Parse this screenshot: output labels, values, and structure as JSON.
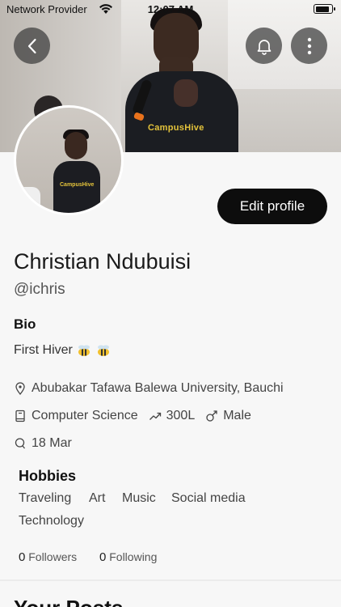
{
  "status_bar": {
    "carrier": "Network Provider",
    "time": "12:07 AM",
    "battery_level": 0.9
  },
  "header": {
    "back_icon": "chevron-left-icon",
    "notification_icon": "bell-icon",
    "more_icon": "more-vertical-icon"
  },
  "cover": {
    "shirt_text": "CampusHive"
  },
  "profile": {
    "edit_label": "Edit profile",
    "name": "Christian Ndubuisi",
    "handle": "@ichris",
    "bio_heading": "Bio",
    "bio_text": "First Hiver",
    "bio_emoji": "bee-emoji",
    "university": "Abubakar Tafawa Balewa University, Bauchi",
    "department": "Computer Science",
    "level": "300L",
    "gender": "Male",
    "birthday": "18 Mar"
  },
  "hobbies": {
    "heading": "Hobbies",
    "items": [
      "Traveling",
      "Art",
      "Music",
      "Social media",
      "Technology"
    ]
  },
  "stats": {
    "followers_count": "0",
    "followers_label": "Followers",
    "following_count": "0",
    "following_label": "Following"
  },
  "posts": {
    "heading": "Your Posts"
  },
  "colors": {
    "background": "#f7f7f7",
    "button_dark": "#0d0d0d",
    "overlay_button": "#3c3c3c"
  }
}
